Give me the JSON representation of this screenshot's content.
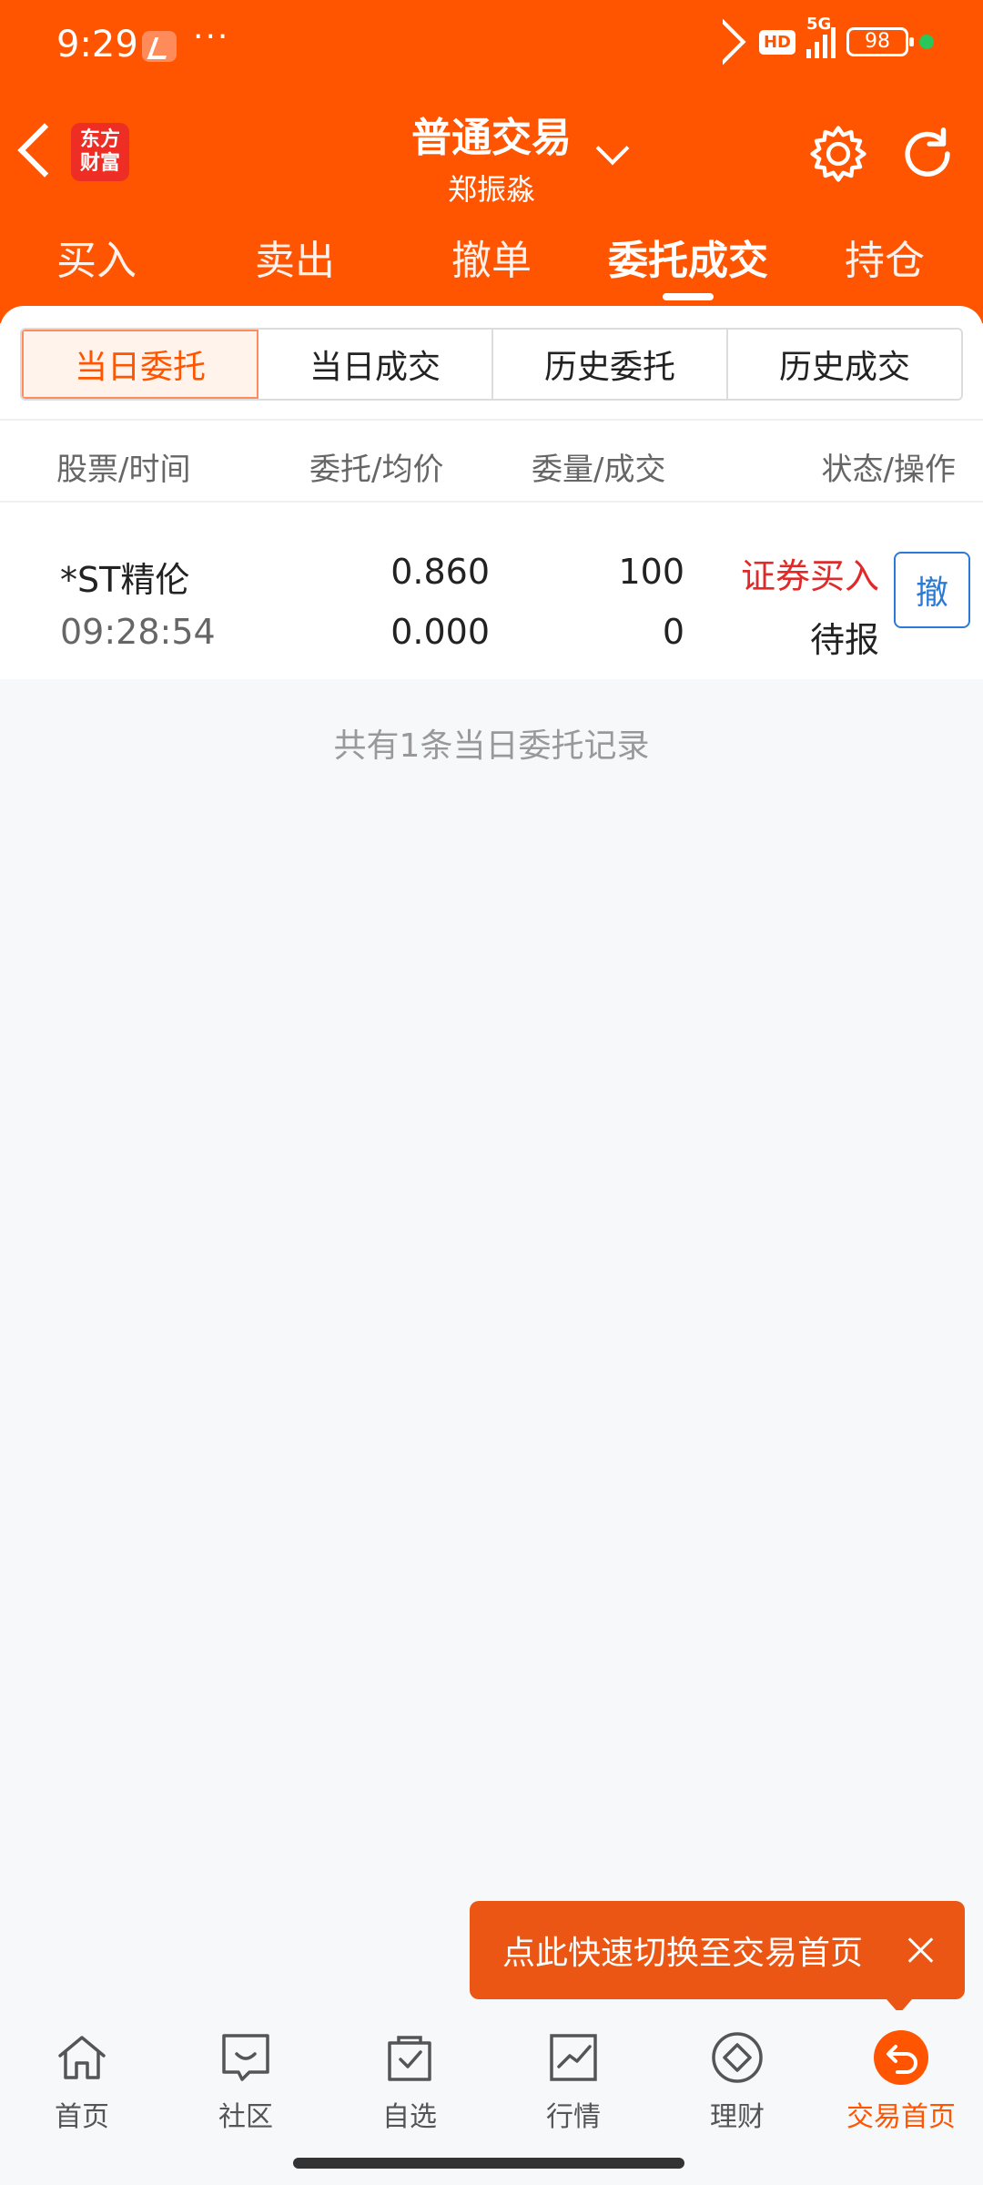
{
  "status_bar": {
    "time": "9:29",
    "dots": "···",
    "hd": "HD",
    "network": "5G",
    "battery": "98"
  },
  "header": {
    "logo_text": "东方财富",
    "title": "普通交易",
    "subtitle": "郑振淼"
  },
  "main_tabs": [
    {
      "label": "买入"
    },
    {
      "label": "卖出"
    },
    {
      "label": "撤单"
    },
    {
      "label": "委托成交"
    },
    {
      "label": "持仓"
    }
  ],
  "segments": [
    {
      "label": "当日委托"
    },
    {
      "label": "当日成交"
    },
    {
      "label": "历史委托"
    },
    {
      "label": "历史成交"
    }
  ],
  "columns": [
    "股票/时间",
    "委托/均价",
    "委量/成交",
    "状态/操作"
  ],
  "orders": [
    {
      "stock": "*ST精伦",
      "time": "09:28:54",
      "price": "0.860",
      "avg_price": "0.000",
      "quantity": "100",
      "filled": "0",
      "status": "证券买入",
      "state": "待报",
      "cancel_label": "撤"
    }
  ],
  "summary": "共有1条当日委托记录",
  "toast": {
    "text": "点此快速切换至交易首页"
  },
  "bottom_nav": [
    {
      "label": "首页"
    },
    {
      "label": "社区"
    },
    {
      "label": "自选"
    },
    {
      "label": "行情"
    },
    {
      "label": "理财"
    },
    {
      "label": "交易首页"
    }
  ],
  "colors": {
    "brand": "#ff5500",
    "sell_red": "#e02a2a",
    "link_blue": "#2b7bd6"
  }
}
